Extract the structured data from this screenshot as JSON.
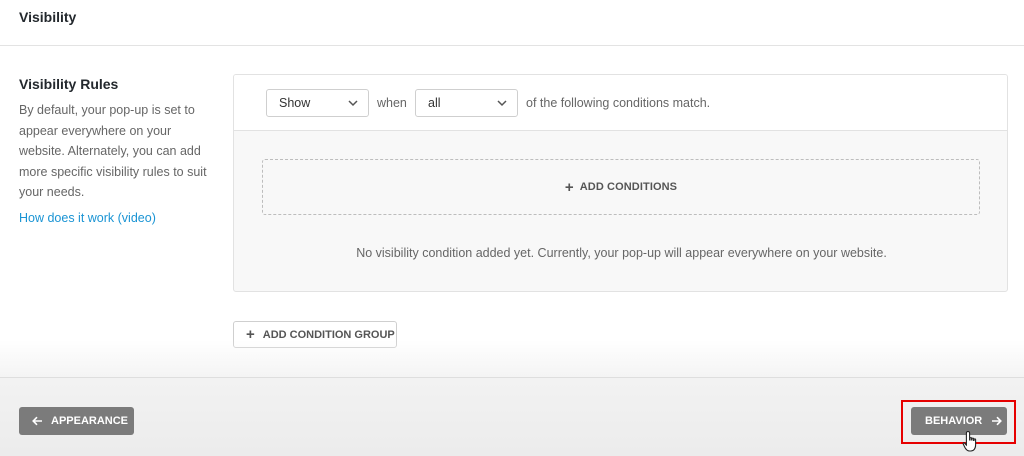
{
  "header": {
    "title": "Visibility"
  },
  "sidebar": {
    "heading": "Visibility Rules",
    "description": "By default, your pop-up is set to appear everywhere on your website. Alternately, you can add more specific visibility rules to suit your needs.",
    "link_label": "How does it work (video)"
  },
  "rules": {
    "action_select": {
      "value": "Show"
    },
    "when_label": "when",
    "match_select": {
      "value": "all"
    },
    "match_suffix": "of the following conditions match.",
    "add_conditions_label": "ADD CONDITIONS",
    "empty_message": "No visibility condition added yet. Currently, your pop-up will appear everywhere on your website."
  },
  "add_group_label": "ADD CONDITION GROUP",
  "footer": {
    "back_label": "APPEARANCE",
    "next_label": "BEHAVIOR"
  },
  "colors": {
    "link": "#1a94d4",
    "nav_button": "#7b7b7b",
    "highlight": "#e60000"
  },
  "icons": {
    "plus": "plus-icon",
    "back": "arrow-left-icon",
    "next": "arrow-right-icon",
    "chevron": "chevron-down-icon",
    "cursor": "hand-pointer-icon"
  }
}
